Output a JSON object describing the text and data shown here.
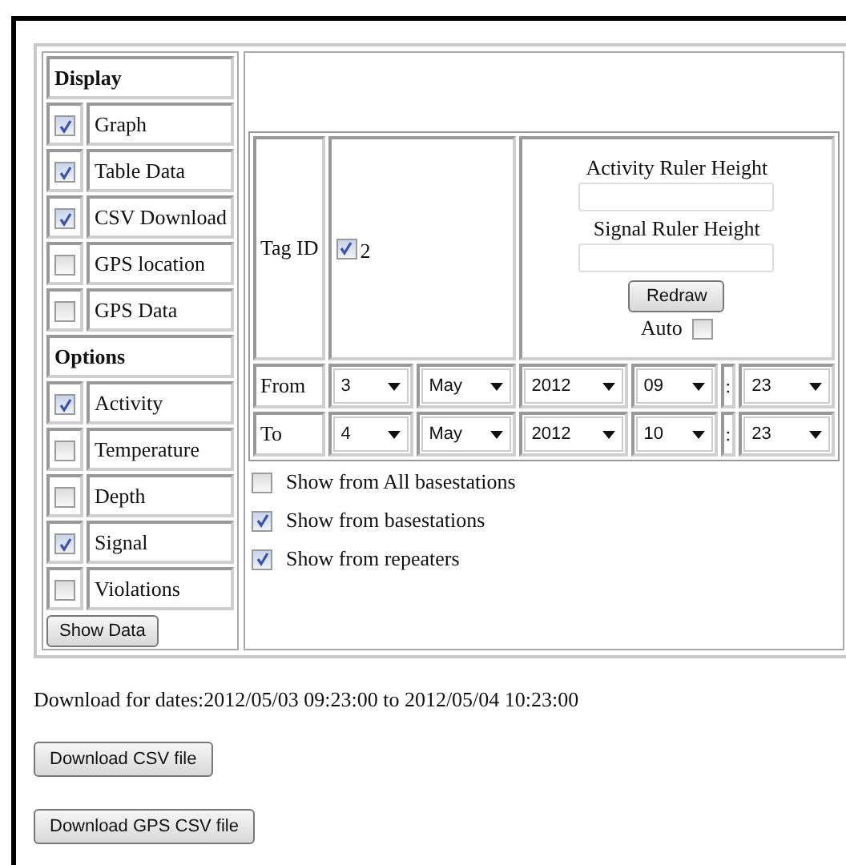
{
  "display": {
    "heading": "Display",
    "items": [
      {
        "label": "Graph",
        "checked": true
      },
      {
        "label": "Table Data",
        "checked": true
      },
      {
        "label": "CSV Download",
        "checked": true
      },
      {
        "label": "GPS location",
        "checked": false
      },
      {
        "label": "GPS Data",
        "checked": false
      }
    ]
  },
  "options": {
    "heading": "Options",
    "items": [
      {
        "label": "Activity",
        "checked": true
      },
      {
        "label": "Temperature",
        "checked": false
      },
      {
        "label": "Depth",
        "checked": false
      },
      {
        "label": "Signal",
        "checked": true
      },
      {
        "label": "Violations",
        "checked": false
      }
    ]
  },
  "show_data_button": "Show Data",
  "tag": {
    "label": "Tag ID",
    "value": "2",
    "checked": true
  },
  "rulers": {
    "activity_label": "Activity Ruler Height",
    "signal_label": "Signal Ruler Height",
    "redraw_button": "Redraw",
    "auto_label": "Auto",
    "auto_checked": false
  },
  "date_rows": [
    {
      "label": "From",
      "day": "3",
      "month": "May",
      "year": "2012",
      "hour": "09",
      "separator": ":",
      "minute": "23"
    },
    {
      "label": "To",
      "day": "4",
      "month": "May",
      "year": "2012",
      "hour": "10",
      "separator": ":",
      "minute": "23"
    }
  ],
  "sources": [
    {
      "label": "Show from All basestations",
      "checked": false
    },
    {
      "label": "Show from basestations",
      "checked": true
    },
    {
      "label": "Show from repeaters",
      "checked": true
    }
  ],
  "download_text": "Download for dates:2012/05/03 09:23:00 to 2012/05/04 10:23:00",
  "buttons": [
    "Download CSV file",
    "Download GPS CSV file"
  ]
}
